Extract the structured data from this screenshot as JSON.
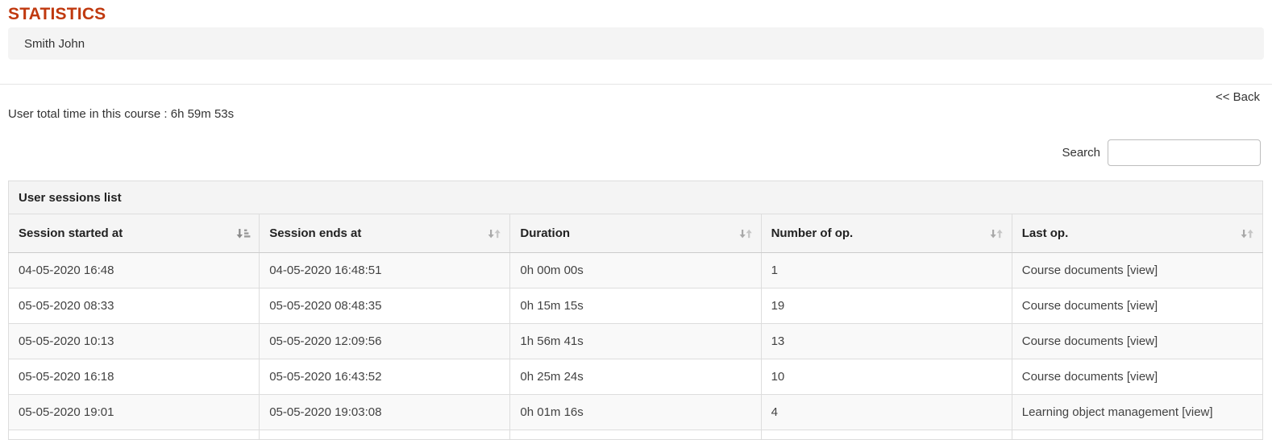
{
  "header": {
    "title": "STATISTICS",
    "user_name": "Smith John"
  },
  "nav": {
    "back_label": "<< Back"
  },
  "summary": {
    "total_time": "User total time in this course : 6h 59m 53s"
  },
  "search": {
    "label": "Search",
    "value": "",
    "placeholder": ""
  },
  "table": {
    "caption": "User sessions list",
    "columns": [
      {
        "label": "Session started at",
        "sort_state": "sorted",
        "icon": "sort-amount-asc-icon"
      },
      {
        "label": "Session ends at",
        "sort_state": "unsorted",
        "icon": "sort-both-icon"
      },
      {
        "label": "Duration",
        "sort_state": "unsorted",
        "icon": "sort-both-icon"
      },
      {
        "label": "Number of op.",
        "sort_state": "unsorted",
        "icon": "sort-both-icon"
      },
      {
        "label": "Last op.",
        "sort_state": "unsorted",
        "icon": "sort-both-icon"
      }
    ],
    "rows": [
      [
        "04-05-2020 16:48",
        "04-05-2020 16:48:51",
        "0h 00m 00s",
        "1",
        "Course documents [view]"
      ],
      [
        "05-05-2020 08:33",
        "05-05-2020 08:48:35",
        "0h 15m 15s",
        "19",
        "Course documents [view]"
      ],
      [
        "05-05-2020 10:13",
        "05-05-2020 12:09:56",
        "1h 56m 41s",
        "13",
        "Course documents [view]"
      ],
      [
        "05-05-2020 16:18",
        "05-05-2020 16:43:52",
        "0h 25m 24s",
        "10",
        "Course documents [view]"
      ],
      [
        "05-05-2020 19:01",
        "05-05-2020 19:03:08",
        "0h 01m 16s",
        "4",
        "Learning object management [view]"
      ]
    ]
  },
  "colors": {
    "title_accent": "#c0390f",
    "panel_bg": "#f4f4f4",
    "header_bg": "#f5f5f5",
    "stripe_bg": "#f9f9f9",
    "border": "#dddddd",
    "text": "#333333",
    "sort_active": "#8a8a8a",
    "sort_inactive": "#bcbcbc"
  }
}
